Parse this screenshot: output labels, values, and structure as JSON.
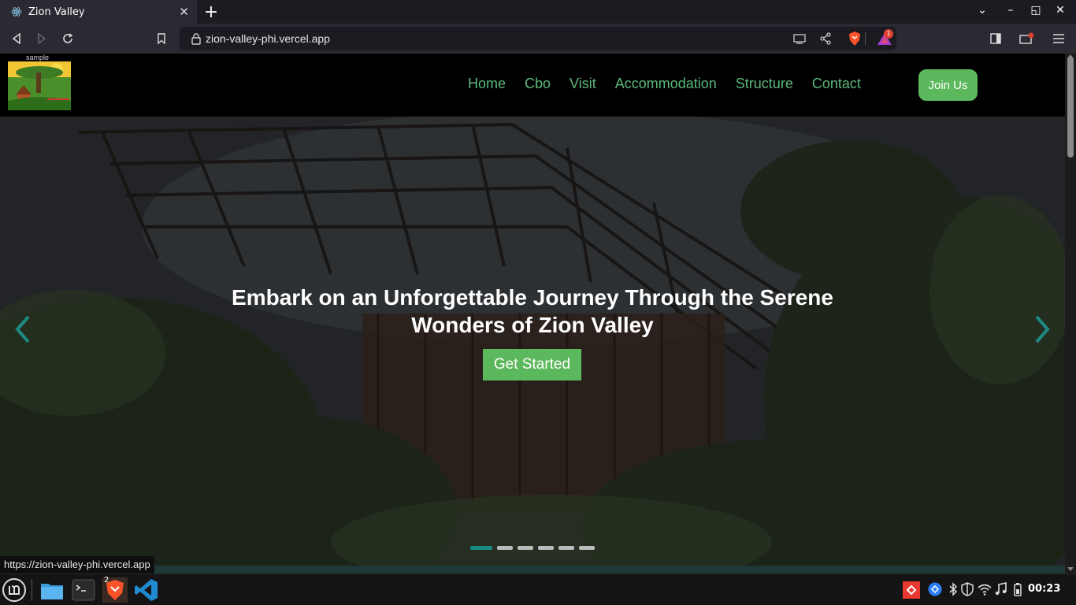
{
  "browser": {
    "tab_title": "Zion Valley",
    "url": "zion-valley-phi.vercel.app",
    "rewards_count": "1"
  },
  "site": {
    "logo_caption": "sample",
    "nav": [
      "Home",
      "Cbo",
      "Visit",
      "Accommodation",
      "Structure",
      "Contact"
    ],
    "join_label": "Join Us",
    "brand_color": "#5cb85c",
    "hero_title": "Embark on an Unforgettable Journey Through the Serene Wonders of Zion Valley",
    "cta_label": "Get Started",
    "slide_count": 6,
    "active_slide": 1
  },
  "status_tooltip": "https://zion-valley-phi.vercel.app",
  "taskbar": {
    "brave_badge": "2",
    "clock": "00:23"
  }
}
